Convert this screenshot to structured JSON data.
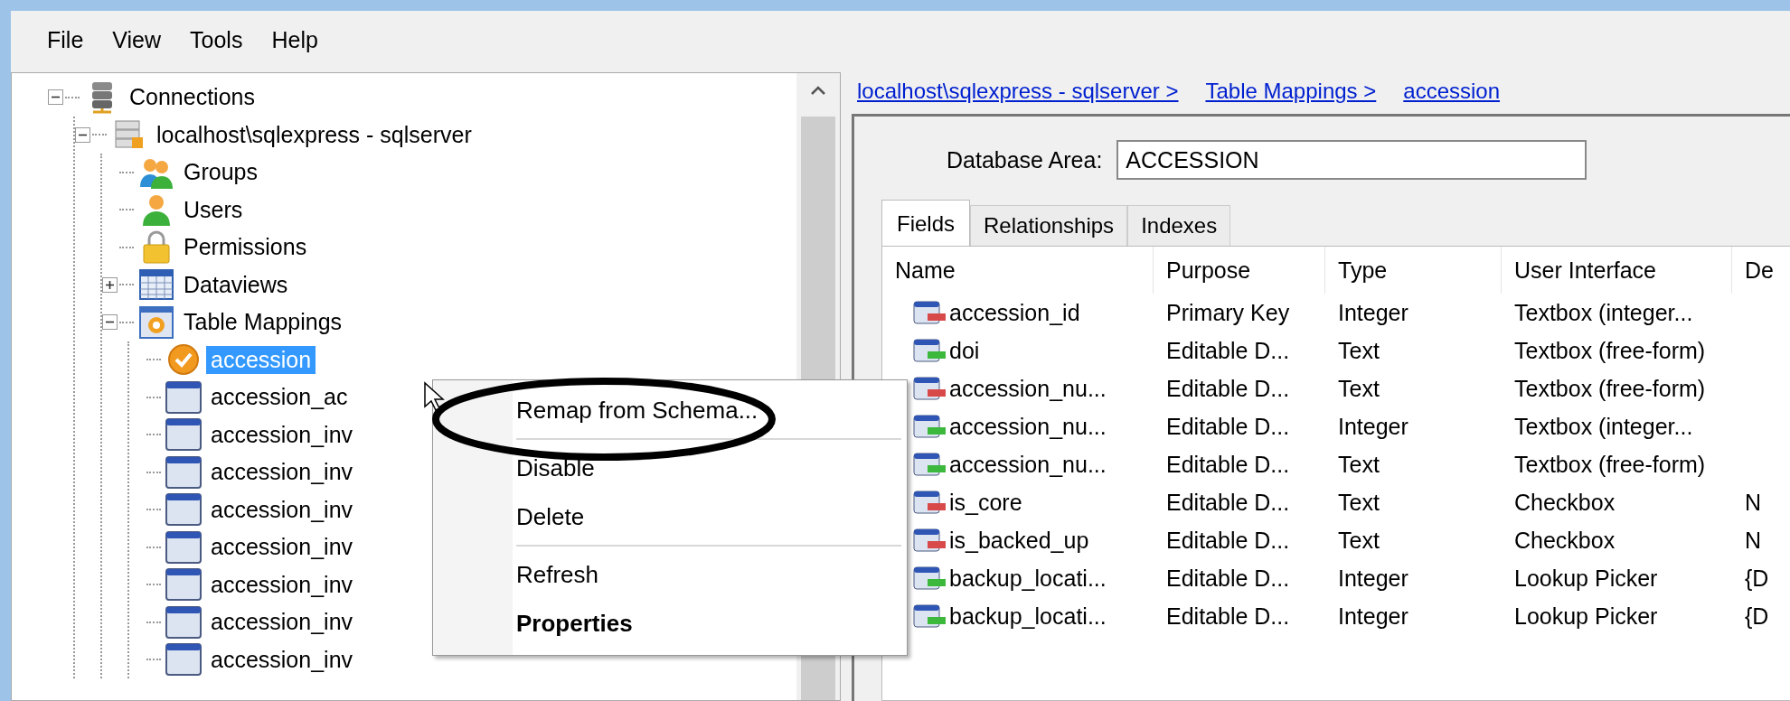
{
  "menu": [
    "File",
    "View",
    "Tools",
    "Help"
  ],
  "tree": {
    "nodes": [
      {
        "label": "Connections",
        "kind": "server-stack",
        "expanded": true,
        "selected": false,
        "children": [
          {
            "label": "localhost\\sqlexpress - sqlserver",
            "kind": "server",
            "expanded": true,
            "selected": false,
            "children": [
              {
                "label": "Groups",
                "kind": "group",
                "selected": false
              },
              {
                "label": "Users",
                "kind": "user",
                "selected": false
              },
              {
                "label": "Permissions",
                "kind": "lock",
                "selected": false
              },
              {
                "label": "Dataviews",
                "kind": "grid",
                "expanded": false,
                "selected": false
              },
              {
                "label": "Table Mappings",
                "kind": "gear",
                "expanded": true,
                "selected": false,
                "children": [
                  {
                    "label": "accession",
                    "kind": "check",
                    "selected": true
                  },
                  {
                    "label": "accession_ac",
                    "kind": "table",
                    "selected": false
                  },
                  {
                    "label": "accession_inv",
                    "kind": "table",
                    "selected": false
                  },
                  {
                    "label": "accession_inv",
                    "kind": "table",
                    "selected": false
                  },
                  {
                    "label": "accession_inv",
                    "kind": "table",
                    "selected": false
                  },
                  {
                    "label": "accession_inv",
                    "kind": "table",
                    "selected": false
                  },
                  {
                    "label": "accession_inv",
                    "kind": "table",
                    "selected": false
                  },
                  {
                    "label": "accession_inv",
                    "kind": "table",
                    "selected": false
                  },
                  {
                    "label": "accession_inv",
                    "kind": "table",
                    "selected": false
                  }
                ]
              }
            ]
          }
        ]
      }
    ]
  },
  "breadcrumb": [
    "localhost\\sqlexpress - sqlserver >",
    "Table Mappings >",
    "accession"
  ],
  "database_area": {
    "label": "Database Area:",
    "value": "ACCESSION"
  },
  "tabs": [
    {
      "label": "Fields",
      "selected": true
    },
    {
      "label": "Relationships",
      "selected": false
    },
    {
      "label": "Indexes",
      "selected": false
    }
  ],
  "table": {
    "columns": [
      "Name",
      "Purpose",
      "Type",
      "User Interface",
      "De"
    ],
    "rows": [
      {
        "color": "#d84a4a",
        "cells": [
          "accession_id",
          "Primary Key",
          "Integer",
          "Textbox (integer..."
        ]
      },
      {
        "color": "#3cb83c",
        "cells": [
          "doi",
          "Editable D...",
          "Text",
          "Textbox (free-form)"
        ]
      },
      {
        "color": "#d84a4a",
        "cells": [
          "accession_nu...",
          "Editable D...",
          "Text",
          "Textbox (free-form)"
        ]
      },
      {
        "color": "#3cb83c",
        "cells": [
          "accession_nu...",
          "Editable D...",
          "Integer",
          "Textbox (integer..."
        ]
      },
      {
        "color": "#3cb83c",
        "cells": [
          "accession_nu...",
          "Editable D...",
          "Text",
          "Textbox (free-form)"
        ]
      },
      {
        "color": "#d84a4a",
        "cells": [
          "is_core",
          "Editable D...",
          "Text",
          "Checkbox",
          "N"
        ]
      },
      {
        "color": "#d84a4a",
        "cells": [
          "is_backed_up",
          "Editable D...",
          "Text",
          "Checkbox",
          "N"
        ]
      },
      {
        "color": "#3cb83c",
        "cells": [
          "backup_locati...",
          "Editable D...",
          "Integer",
          "Lookup Picker",
          "{D"
        ]
      },
      {
        "color": "#3cb83c",
        "cells": [
          "backup_locati...",
          "Editable D...",
          "Integer",
          "Lookup Picker",
          "{D"
        ]
      }
    ]
  },
  "context_menu": {
    "items": [
      {
        "kind": "item",
        "label": "Remap from Schema...",
        "default": false
      },
      {
        "kind": "separator"
      },
      {
        "kind": "item",
        "label": "Disable",
        "default": false
      },
      {
        "kind": "item",
        "label": "Delete",
        "default": false
      },
      {
        "kind": "separator"
      },
      {
        "kind": "item",
        "label": "Refresh",
        "default": false
      },
      {
        "kind": "item",
        "label": "Properties",
        "default": true
      }
    ]
  }
}
